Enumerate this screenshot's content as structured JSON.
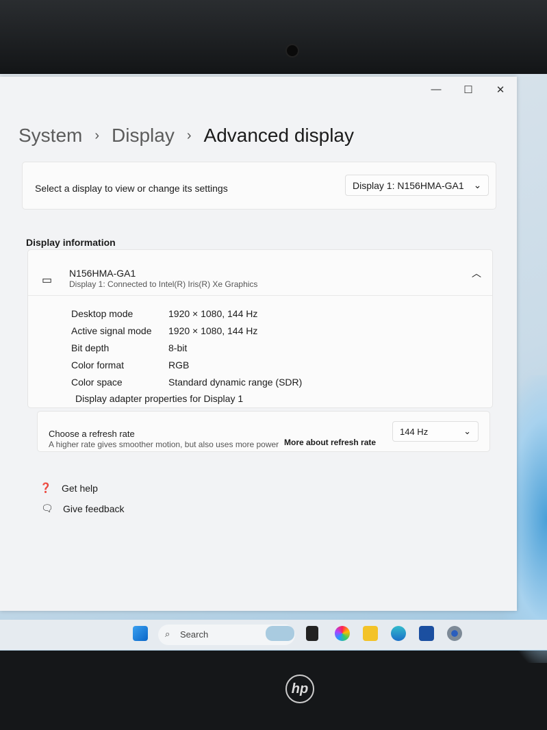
{
  "breadcrumb": {
    "items": [
      "System",
      "Display"
    ],
    "current": "Advanced display"
  },
  "select_display": {
    "label": "Select a display to view or change its settings",
    "value": "Display 1: N156HMA-GA1"
  },
  "section_title": "Display information",
  "display": {
    "name": "N156HMA-GA1",
    "subtitle": "Display 1: Connected to Intel(R) Iris(R) Xe Graphics",
    "rows": [
      {
        "k": "Desktop mode",
        "v": "1920 × 1080, 144 Hz"
      },
      {
        "k": "Active signal mode",
        "v": "1920 × 1080, 144 Hz"
      },
      {
        "k": "Bit depth",
        "v": "8-bit"
      },
      {
        "k": "Color format",
        "v": "RGB"
      },
      {
        "k": "Color space",
        "v": "Standard dynamic range (SDR)"
      }
    ],
    "adapter_link": "Display adapter properties for Display 1"
  },
  "refresh": {
    "title": "Choose a refresh rate",
    "desc": "A higher rate gives smoother motion, but also uses more power",
    "link": "More about refresh rate",
    "value": "144 Hz"
  },
  "help": {
    "get_help": "Get help",
    "feedback": "Give feedback"
  },
  "taskbar": {
    "search": "Search"
  },
  "brand": "hp"
}
